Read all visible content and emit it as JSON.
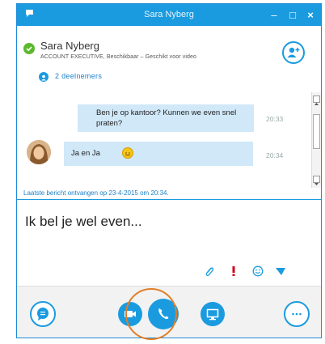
{
  "window": {
    "title": "Sara Nyberg",
    "controls": [
      "–",
      "□",
      "×"
    ]
  },
  "contact": {
    "name": "Sara Nyberg",
    "status": "ACCOUNT EXECUTIVE, Beschikbaar – Geschikt voor video",
    "participants": "2 deelnemers"
  },
  "messages": [
    {
      "text": "Ben je op kantoor? Kunnen we even snel praten?",
      "time": "20:33"
    },
    {
      "text": "Ja en Ja",
      "time": "20:34"
    }
  ],
  "last_message": "Laatste bericht ontvangen op 23-4-2015 om 20:34.",
  "compose": {
    "text": "Ik bel je wel even..."
  },
  "colors": {
    "accent": "#1a9be0",
    "highlight": "#e07e28",
    "bubble": "#d0e8f8"
  }
}
